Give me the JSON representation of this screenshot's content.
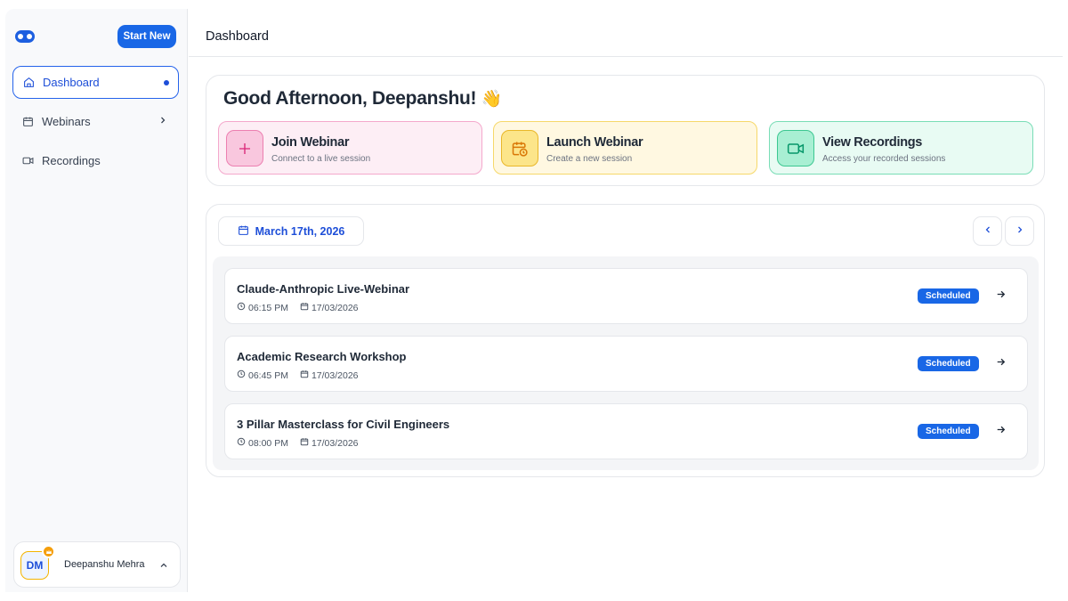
{
  "sidebar": {
    "start_label": "Start New",
    "items": [
      {
        "label": "Dashboard",
        "icon": "home-icon",
        "active": true
      },
      {
        "label": "Webinars",
        "icon": "calendar-icon"
      },
      {
        "label": "Recordings",
        "icon": "video-icon"
      }
    ],
    "user": {
      "initials": "DM",
      "name": "Deepanshu Mehra"
    }
  },
  "header": {
    "title": "Dashboard"
  },
  "greeting": {
    "text": "Good Afternoon, Deepanshu!",
    "emoji": "👋"
  },
  "actions": [
    {
      "title": "Join Webinar",
      "subtitle": "Connect to a live session",
      "icon": "plus-icon",
      "color": "#ec4899"
    },
    {
      "title": "Launch Webinar",
      "subtitle": "Create a new session",
      "icon": "calendar-clock-icon",
      "color": "#d97706"
    },
    {
      "title": "View Recordings",
      "subtitle": "Access your recorded sessions",
      "icon": "video-icon",
      "color": "#059669"
    }
  ],
  "date_label": "March 17th, 2026",
  "sessions": [
    {
      "title": "Claude-Anthropic Live-Webinar",
      "time": "06:15 PM",
      "date": "17/03/2026",
      "status": "Scheduled"
    },
    {
      "title": "Academic Research Workshop",
      "time": "06:45 PM",
      "date": "17/03/2026",
      "status": "Scheduled"
    },
    {
      "title": "3 Pillar Masterclass for Civil Engineers",
      "time": "08:00 PM",
      "date": "17/03/2026",
      "status": "Scheduled"
    }
  ],
  "colors": {
    "accent": "#1967e6",
    "active_nav": "#1d4ed8"
  }
}
